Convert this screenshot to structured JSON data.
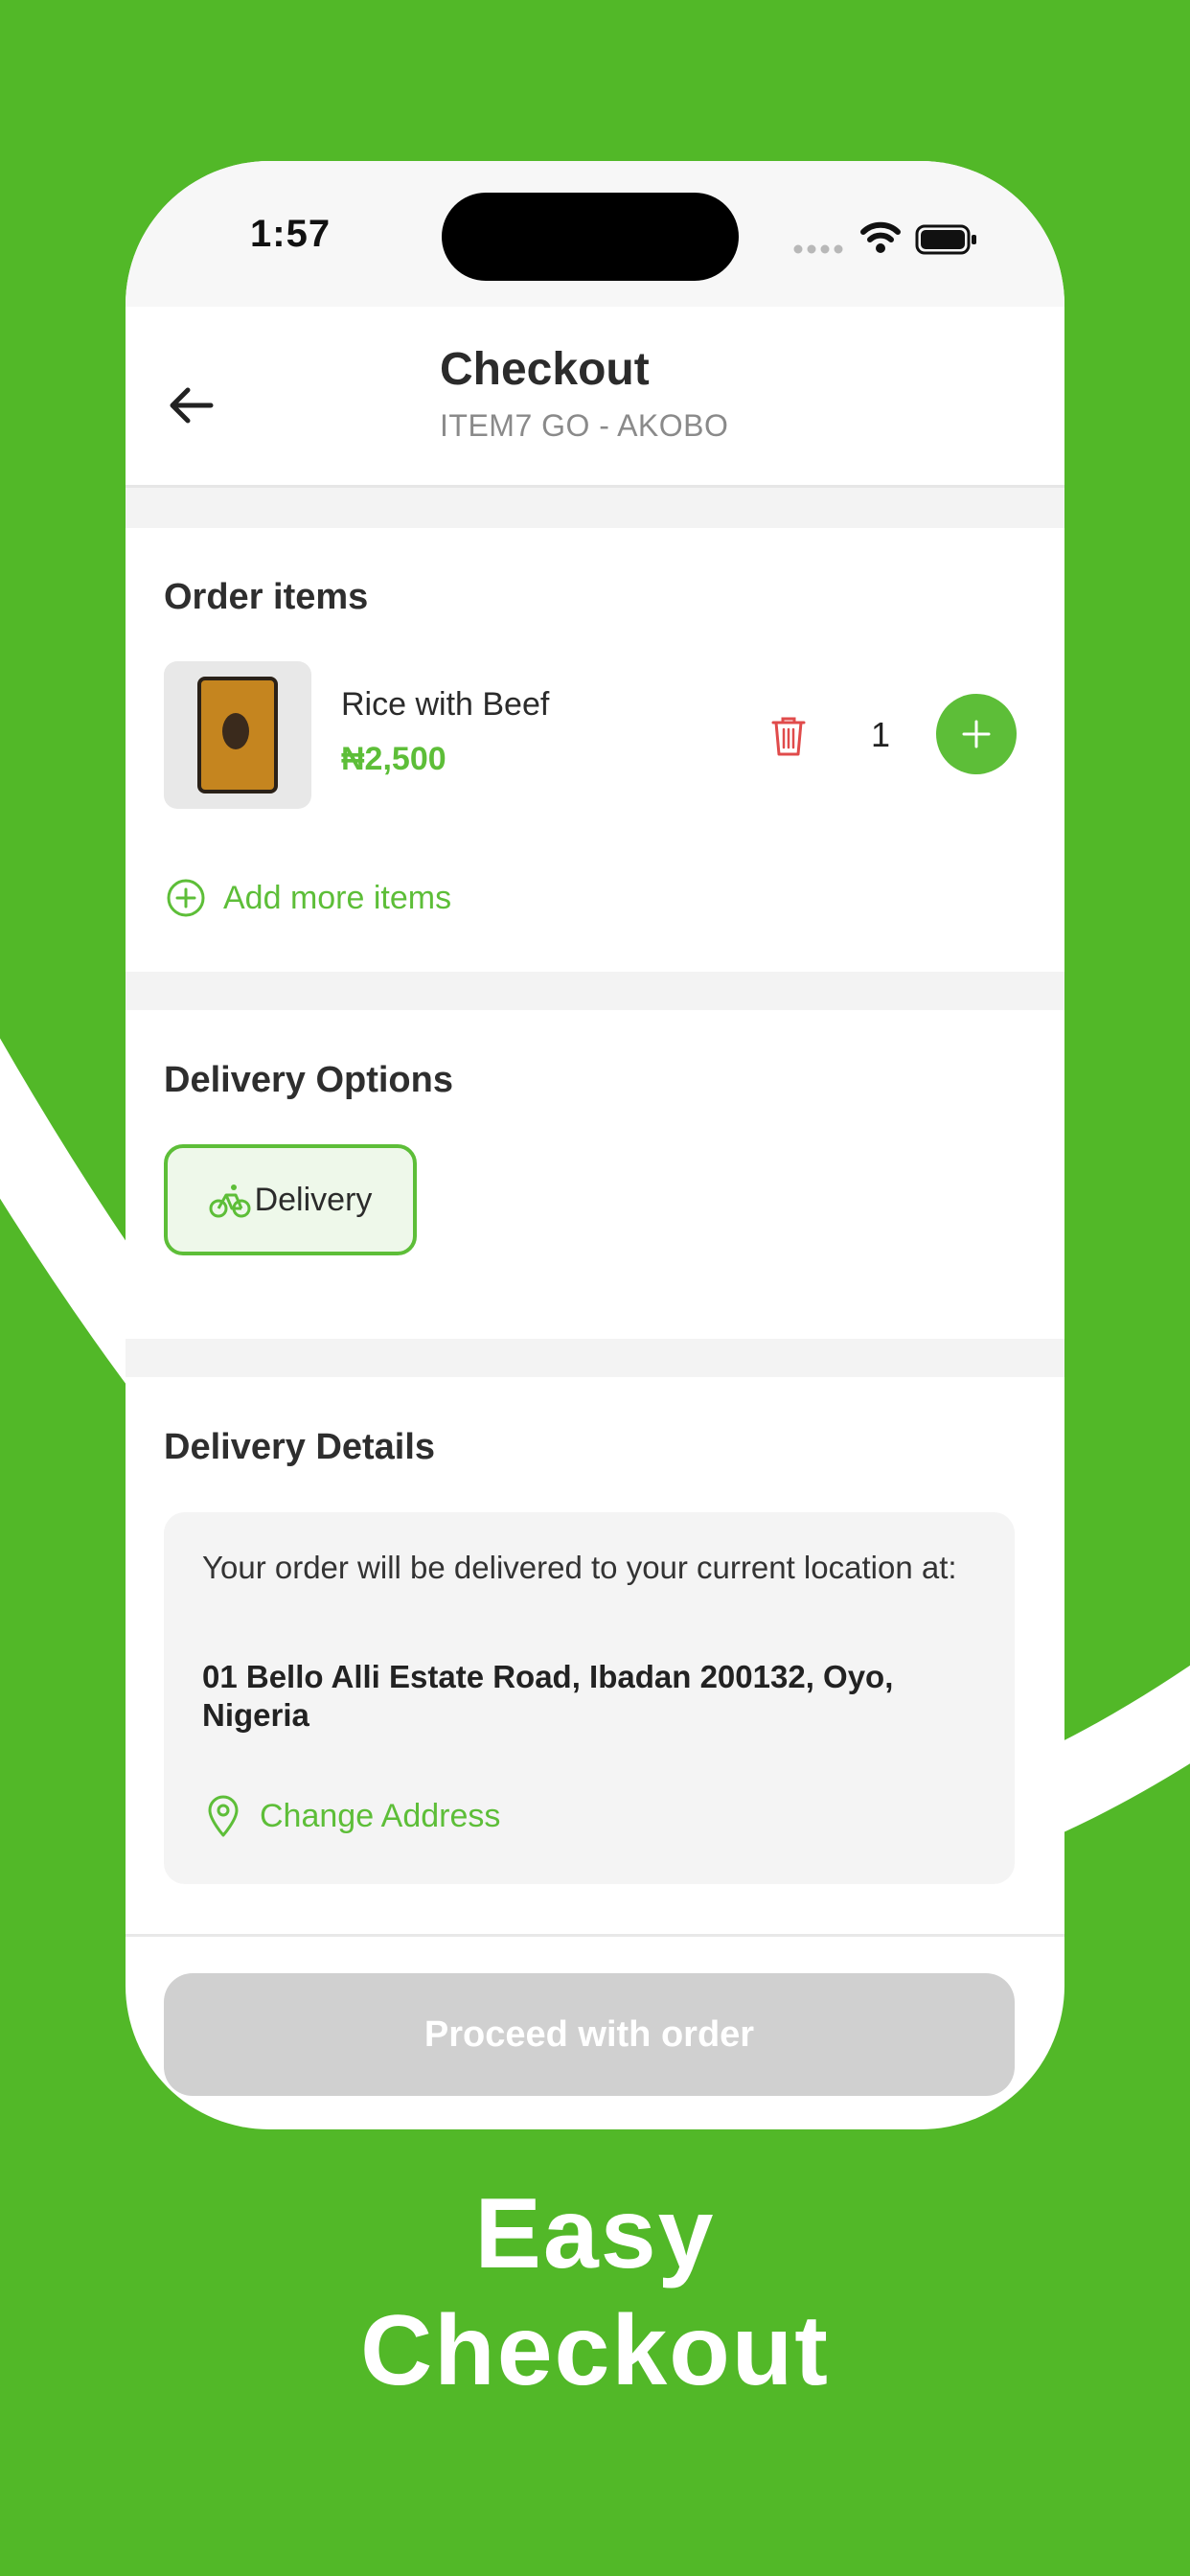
{
  "status_bar": {
    "time": "1:57"
  },
  "header": {
    "title": "Checkout",
    "subtitle": "ITEM7 GO - AKOBO"
  },
  "order_items": {
    "section_title": "Order  items",
    "items": [
      {
        "name": "Rice with Beef",
        "price": "₦2,500",
        "quantity": "1"
      }
    ],
    "add_more_label": "Add more items"
  },
  "delivery_options": {
    "section_title": "Delivery Options",
    "selected_option": "Delivery"
  },
  "delivery_details": {
    "section_title": "Delivery Details",
    "message": "Your order will be delivered to your current location at:",
    "address": "01 Bello Alli Estate Road, Ibadan 200132, Oyo, Nigeria",
    "change_address_label": "Change Address"
  },
  "footer": {
    "proceed_label": "Proceed with order"
  },
  "promo": {
    "line1": "Easy",
    "line2": "Checkout"
  },
  "colors": {
    "brand_green": "#5dbe38",
    "background_green": "#52b828",
    "delete_red": "#e04b4b",
    "disabled_button": "#d0d0d0"
  }
}
